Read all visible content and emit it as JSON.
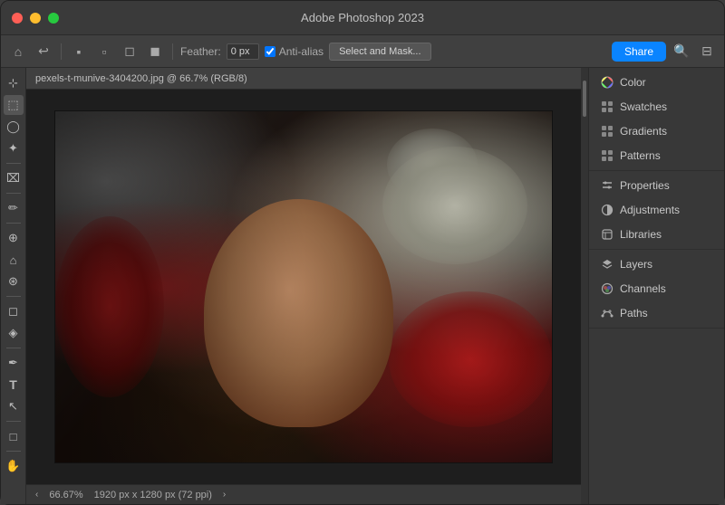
{
  "window": {
    "title": "Adobe Photoshop 2023"
  },
  "toolbar": {
    "feather_label": "Feather:",
    "feather_value": "0 px",
    "anti_alias_label": "Anti-alias",
    "select_mask_btn": "Select and Mask...",
    "share_btn": "Share"
  },
  "canvas": {
    "tab_title": "pexels-t-munive-3404200.jpg @ 66.7% (RGB/8)"
  },
  "status_bar": {
    "zoom": "66.67%",
    "dimensions": "1920 px x 1280 px (72 ppi)"
  },
  "left_tools": [
    {
      "name": "move",
      "icon": "⊹",
      "label": "Move Tool"
    },
    {
      "name": "marquee-rect",
      "icon": "⬚",
      "label": "Rectangular Marquee Tool"
    },
    {
      "name": "lasso",
      "icon": "◯",
      "label": "Lasso Tool"
    },
    {
      "name": "magic-wand",
      "icon": "✦",
      "label": "Magic Wand Tool"
    },
    {
      "name": "crop",
      "icon": "⌧",
      "label": "Crop Tool"
    },
    {
      "name": "eyedropper",
      "icon": "✏",
      "label": "Eyedropper Tool"
    },
    {
      "name": "spot-heal",
      "icon": "⊕",
      "label": "Spot Healing Tool"
    },
    {
      "name": "brush",
      "icon": "⌂",
      "label": "Brush Tool"
    },
    {
      "name": "clone",
      "icon": "⊛",
      "label": "Clone Stamp Tool"
    },
    {
      "name": "eraser",
      "icon": "◻",
      "label": "Eraser Tool"
    },
    {
      "name": "gradient",
      "icon": "◈",
      "label": "Gradient Tool"
    },
    {
      "name": "pen",
      "icon": "✒",
      "label": "Pen Tool"
    },
    {
      "name": "text",
      "icon": "T",
      "label": "Type Tool"
    },
    {
      "name": "path-select",
      "icon": "↖",
      "label": "Path Selection Tool"
    },
    {
      "name": "shape",
      "icon": "□",
      "label": "Shape Tool"
    },
    {
      "name": "hand",
      "icon": "✋",
      "label": "Hand Tool"
    }
  ],
  "right_panel": {
    "groups": [
      {
        "items": [
          {
            "name": "Color",
            "icon": "color-wheel"
          },
          {
            "name": "Swatches",
            "icon": "grid"
          },
          {
            "name": "Gradients",
            "icon": "grid"
          },
          {
            "name": "Patterns",
            "icon": "grid"
          }
        ]
      },
      {
        "items": [
          {
            "name": "Properties",
            "icon": "sliders"
          },
          {
            "name": "Adjustments",
            "icon": "circle-half"
          },
          {
            "name": "Libraries",
            "icon": "book"
          }
        ]
      },
      {
        "items": [
          {
            "name": "Layers",
            "icon": "layers"
          },
          {
            "name": "Channels",
            "icon": "circle-channels"
          },
          {
            "name": "Paths",
            "icon": "paths"
          }
        ]
      }
    ]
  }
}
